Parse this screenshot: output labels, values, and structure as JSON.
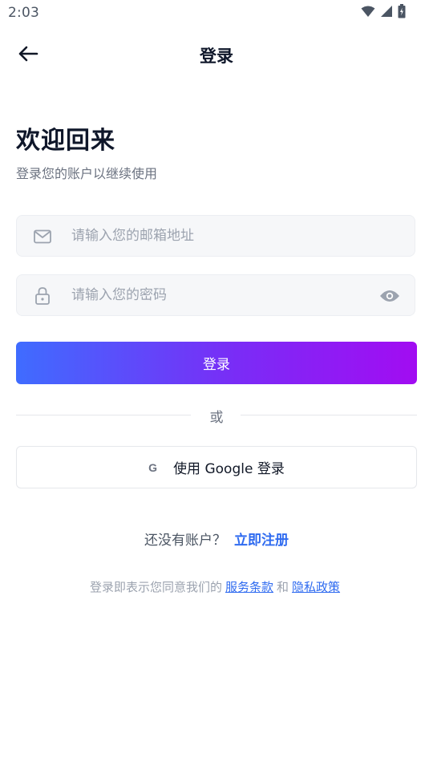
{
  "status_bar": {
    "time": "2:03",
    "icons": [
      "wifi-icon",
      "signal-icon",
      "battery-icon"
    ]
  },
  "app_bar": {
    "back_icon": "arrow-left-icon",
    "title": "登录"
  },
  "header": {
    "title": "欢迎回来",
    "subtitle": "登录您的账户以继续使用"
  },
  "form": {
    "email": {
      "icon": "mail-icon",
      "value": "",
      "placeholder": "请输入您的邮箱地址"
    },
    "password": {
      "icon": "lock-icon",
      "value": "",
      "placeholder": "请输入您的密码",
      "toggle_icon": "eye-icon"
    },
    "submit_label": "登录"
  },
  "divider": {
    "text": "或"
  },
  "google": {
    "icon_text": "G",
    "label": "使用 Google 登录"
  },
  "register": {
    "prompt": "还没有账户？",
    "link": "立即注册"
  },
  "terms": {
    "prefix": "登录即表示您同意我们的",
    "tos": "服务条款",
    "conjunction": "和",
    "privacy": "隐私政策"
  },
  "colors": {
    "primary": "#2f6bf0",
    "gradient_start": "#3f6cff",
    "gradient_end": "#a20cf2",
    "field_background": "#f6f7f9"
  }
}
